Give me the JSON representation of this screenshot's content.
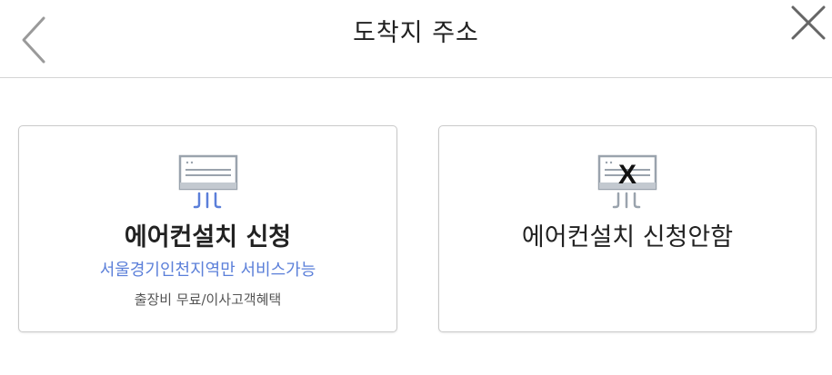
{
  "header": {
    "title": "도착지 주소",
    "back_icon": "chevron-left-icon",
    "close_icon": "close-icon"
  },
  "cards": [
    {
      "title": "에어컨설치 신청",
      "subtitle": "서울경기인천지역만 서비스가능",
      "note": "출장비 무료/이사고객혜택",
      "icon": "air-conditioner-icon",
      "accent": "#5b7fd9"
    },
    {
      "title": "에어컨설치 신청안함",
      "icon": "air-conditioner-crossed-icon",
      "icon_overlay": "X"
    }
  ],
  "colors": {
    "border": "#c9c9c9",
    "divider": "#d4d4d4",
    "icon_gray": "#9aa3ad",
    "accent_blue": "#5b7fd9"
  }
}
